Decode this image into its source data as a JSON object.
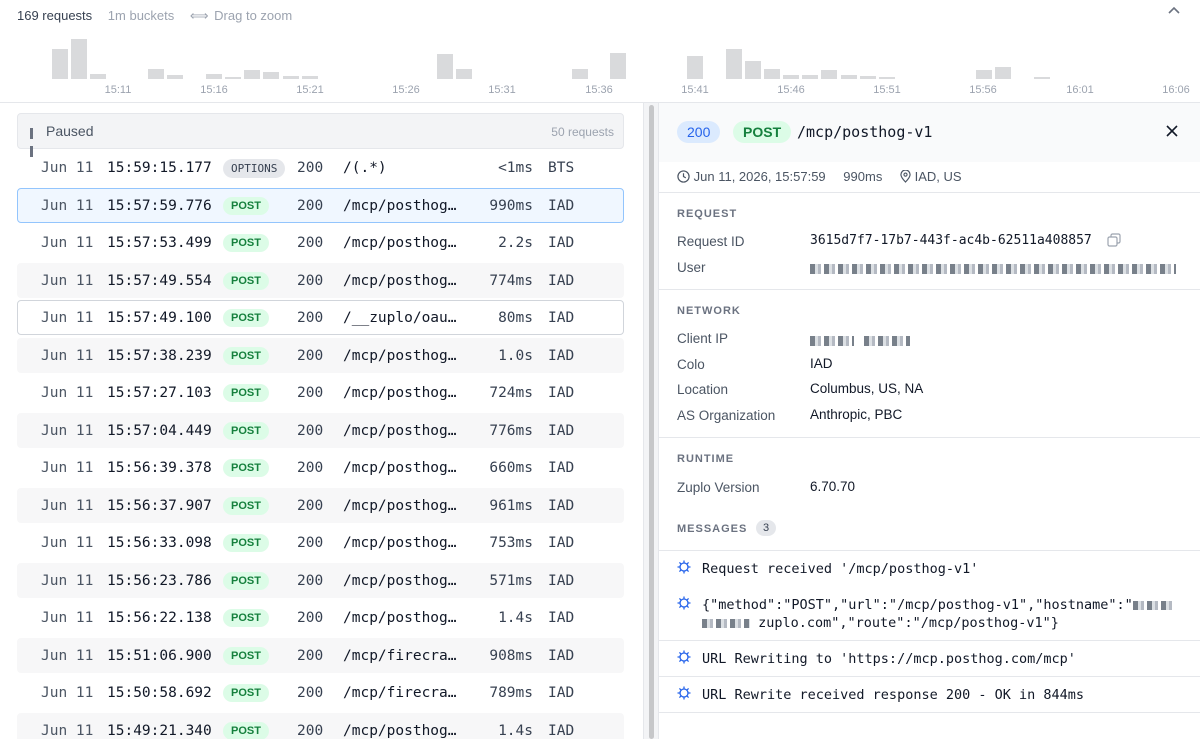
{
  "histogram": {
    "summary": "169 requests",
    "bucket": "1m buckets",
    "drag_hint": "Drag to zoom",
    "ticks": [
      "15:11",
      "15:16",
      "15:21",
      "15:26",
      "15:31",
      "15:36",
      "15:41",
      "15:46",
      "15:51",
      "15:56",
      "16:01",
      "16:06"
    ],
    "bars": [
      0.76,
      1.0,
      0.13,
      0.24,
      0.11,
      0.13,
      0.05,
      0.22,
      0.17,
      0.07,
      0.07,
      0.62,
      0.24,
      0.26,
      0.65,
      0.57,
      0.76,
      0.46,
      0.24,
      0.11,
      0.11,
      0.22,
      0.09,
      0.07,
      0.04,
      0.22,
      0.3,
      0.04
    ]
  },
  "list": {
    "paused_label": "Paused",
    "paused_count": "50 requests",
    "rows": [
      {
        "date": "Jun 11",
        "time": "15:59:15.177",
        "method": "OPTIONS",
        "status": "200",
        "path": "/(.*)",
        "dur": "<1ms",
        "colo": "BTS"
      },
      {
        "date": "Jun 11",
        "time": "15:57:59.776",
        "method": "POST",
        "status": "200",
        "path": "/mcp/posthog…",
        "dur": "990ms",
        "colo": "IAD"
      },
      {
        "date": "Jun 11",
        "time": "15:57:53.499",
        "method": "POST",
        "status": "200",
        "path": "/mcp/posthog…",
        "dur": "2.2s",
        "colo": "IAD"
      },
      {
        "date": "Jun 11",
        "time": "15:57:49.554",
        "method": "POST",
        "status": "200",
        "path": "/mcp/posthog…",
        "dur": "774ms",
        "colo": "IAD"
      },
      {
        "date": "Jun 11",
        "time": "15:57:49.100",
        "method": "POST",
        "status": "200",
        "path": "/__zuplo/oau…",
        "dur": "80ms",
        "colo": "IAD"
      },
      {
        "date": "Jun 11",
        "time": "15:57:38.239",
        "method": "POST",
        "status": "200",
        "path": "/mcp/posthog…",
        "dur": "1.0s",
        "colo": "IAD"
      },
      {
        "date": "Jun 11",
        "time": "15:57:27.103",
        "method": "POST",
        "status": "200",
        "path": "/mcp/posthog…",
        "dur": "724ms",
        "colo": "IAD"
      },
      {
        "date": "Jun 11",
        "time": "15:57:04.449",
        "method": "POST",
        "status": "200",
        "path": "/mcp/posthog…",
        "dur": "776ms",
        "colo": "IAD"
      },
      {
        "date": "Jun 11",
        "time": "15:56:39.378",
        "method": "POST",
        "status": "200",
        "path": "/mcp/posthog…",
        "dur": "660ms",
        "colo": "IAD"
      },
      {
        "date": "Jun 11",
        "time": "15:56:37.907",
        "method": "POST",
        "status": "200",
        "path": "/mcp/posthog…",
        "dur": "961ms",
        "colo": "IAD"
      },
      {
        "date": "Jun 11",
        "time": "15:56:33.098",
        "method": "POST",
        "status": "200",
        "path": "/mcp/posthog…",
        "dur": "753ms",
        "colo": "IAD"
      },
      {
        "date": "Jun 11",
        "time": "15:56:23.786",
        "method": "POST",
        "status": "200",
        "path": "/mcp/posthog…",
        "dur": "571ms",
        "colo": "IAD"
      },
      {
        "date": "Jun 11",
        "time": "15:56:22.138",
        "method": "POST",
        "status": "200",
        "path": "/mcp/posthog…",
        "dur": "1.4s",
        "colo": "IAD"
      },
      {
        "date": "Jun 11",
        "time": "15:51:06.900",
        "method": "POST",
        "status": "200",
        "path": "/mcp/firecra…",
        "dur": "908ms",
        "colo": "IAD"
      },
      {
        "date": "Jun 11",
        "time": "15:50:58.692",
        "method": "POST",
        "status": "200",
        "path": "/mcp/firecra…",
        "dur": "789ms",
        "colo": "IAD"
      },
      {
        "date": "Jun 11",
        "time": "15:49:21.340",
        "method": "POST",
        "status": "200",
        "path": "/mcp/posthog…",
        "dur": "1.4s",
        "colo": "IAD"
      }
    ]
  },
  "detail": {
    "status": "200",
    "method": "POST",
    "path": "/mcp/posthog-v1",
    "timestamp": "Jun 11, 2026, 15:57:59",
    "duration": "990ms",
    "location_short": "IAD, US",
    "request": {
      "title": "REQUEST",
      "id_label": "Request ID",
      "id_value": "3615d7f7-17b7-443f-ac4b-62511a408857",
      "user_label": "User"
    },
    "network": {
      "title": "NETWORK",
      "client_ip_label": "Client IP",
      "colo_label": "Colo",
      "colo_value": "IAD",
      "location_label": "Location",
      "location_value": "Columbus, US, NA",
      "as_label": "AS Organization",
      "as_value": "Anthropic, PBC"
    },
    "runtime": {
      "title": "RUNTIME",
      "version_label": "Zuplo Version",
      "version_value": "6.70.70"
    },
    "messages": {
      "title": "MESSAGES",
      "count": "3",
      "m1": "Request received '/mcp/posthog-v1'",
      "m2_line1": "{\"method\":\"POST\",\"url\":\"/mcp/posthog-v1\",\"hostname\":\"",
      "m2_line2": "zuplo.com\",\"route\":\"/mcp/posthog-v1\"}",
      "m3": "URL Rewriting to 'https://mcp.posthog.com/mcp'",
      "m4": "URL Rewrite received response 200 - OK in 844ms"
    }
  }
}
